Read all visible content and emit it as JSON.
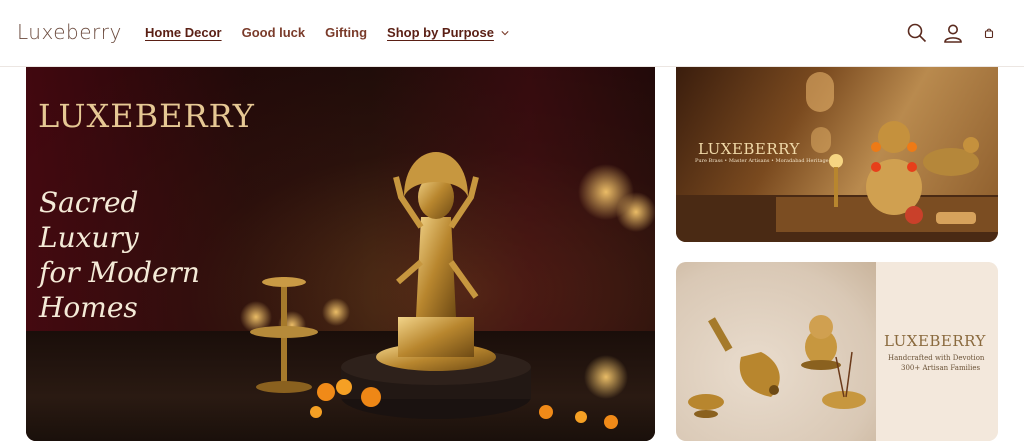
{
  "header": {
    "logo": "Luxeberry",
    "nav": [
      {
        "label": "Home Decor",
        "underlined": true
      },
      {
        "label": "Good luck",
        "underlined": false
      },
      {
        "label": "Gifting",
        "underlined": false
      },
      {
        "label": "Shop by Purpose",
        "underlined": true,
        "dropdown": true
      }
    ],
    "icons": [
      "search-icon",
      "account-icon",
      "cart-icon"
    ]
  },
  "hero": {
    "brand": "LUXEBERRY",
    "tagline_lines": [
      "Sacred",
      "Luxury",
      "for Modern",
      "Homes"
    ]
  },
  "tile_top": {
    "brand": "LUXEBERRY",
    "subline": "Pure Brass • Master Artisans • Moradabad Heritage"
  },
  "tile_bottom": {
    "brand": "LUXEBERRY",
    "subline1": "Handcrafted with Devotion",
    "subline2": "300+ Artisan Families"
  },
  "colors": {
    "brand_text": "#6b4a3d",
    "nav_text": "#7a3b2a",
    "gold": "#e6c894"
  }
}
